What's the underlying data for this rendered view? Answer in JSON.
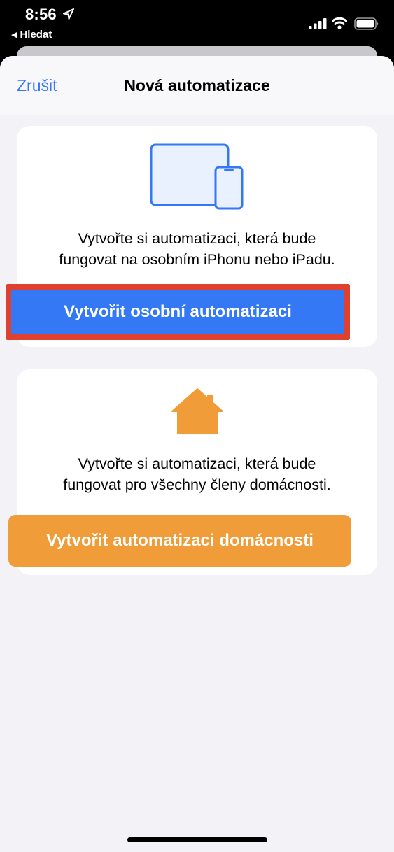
{
  "status_bar": {
    "time": "8:56",
    "back_app_label": "Hledat",
    "icons": [
      "location-arrow-icon",
      "cellular-signal-icon",
      "wifi-icon",
      "battery-icon"
    ]
  },
  "nav": {
    "cancel_label": "Zrušit",
    "title": "Nová automatizace"
  },
  "personal_card": {
    "icon": "ipad-iphone-icon",
    "description_line1": "Vytvořte si automatizaci, která bude",
    "description_line2": "fungovat na osobním iPhonu nebo iPadu.",
    "button_label": "Vytvořit osobní automatizaci",
    "highlighted": true
  },
  "home_card": {
    "icon": "house-icon",
    "description_line1": "Vytvořte si automatizaci, která bude",
    "description_line2": "fungovat pro všechny členy domácnosti.",
    "button_label": "Vytvořit automatizaci domácnosti"
  },
  "colors": {
    "accent_blue": "#3478f6",
    "home_orange": "#f09c38",
    "highlight_red": "#e0402e",
    "background": "#f2f2f7"
  }
}
